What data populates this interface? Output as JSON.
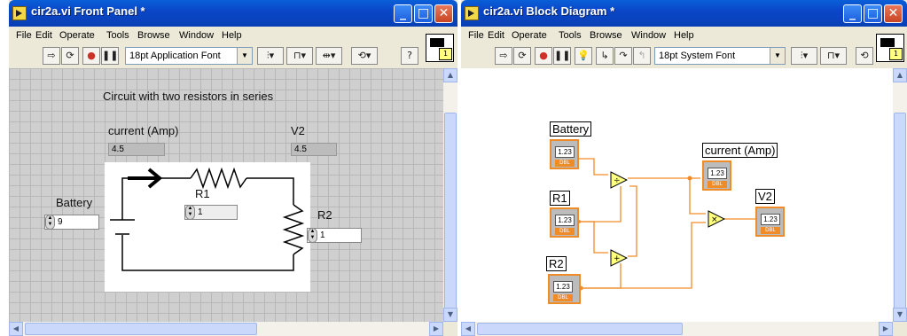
{
  "front_panel": {
    "title": "cir2a.vi Front Panel *",
    "menu": [
      "File",
      "Edit",
      "Operate",
      "Tools",
      "Browse",
      "Window",
      "Help"
    ],
    "font_selector": "18pt Application Font",
    "heading": "Circuit with two resistors in series",
    "current_label": "current (Amp)",
    "current_value": "4.5",
    "v2_label": "V2",
    "v2_value": "4.5",
    "battery_label": "Battery",
    "battery_value": "9",
    "r1_label": "R1",
    "r1_value": "1",
    "r2_label": "R2",
    "r2_value": "1",
    "icon_number": "1"
  },
  "block_diagram": {
    "title": "cir2a.vi Block Diagram *",
    "menu": [
      "File",
      "Edit",
      "Operate",
      "Tools",
      "Browse",
      "Window",
      "Help"
    ],
    "font_selector": "18pt System Font",
    "icon_number": "1",
    "terminals": {
      "battery": "Battery",
      "r1": "R1",
      "r2": "R2",
      "current": "current (Amp)",
      "v2": "V2"
    },
    "terminal_text": "1.23",
    "terminal_type": "DBL"
  },
  "colors": {
    "wire": "#f08c28",
    "titlebar": "#0a50d0",
    "panel_grid": "#cfcfcf"
  }
}
